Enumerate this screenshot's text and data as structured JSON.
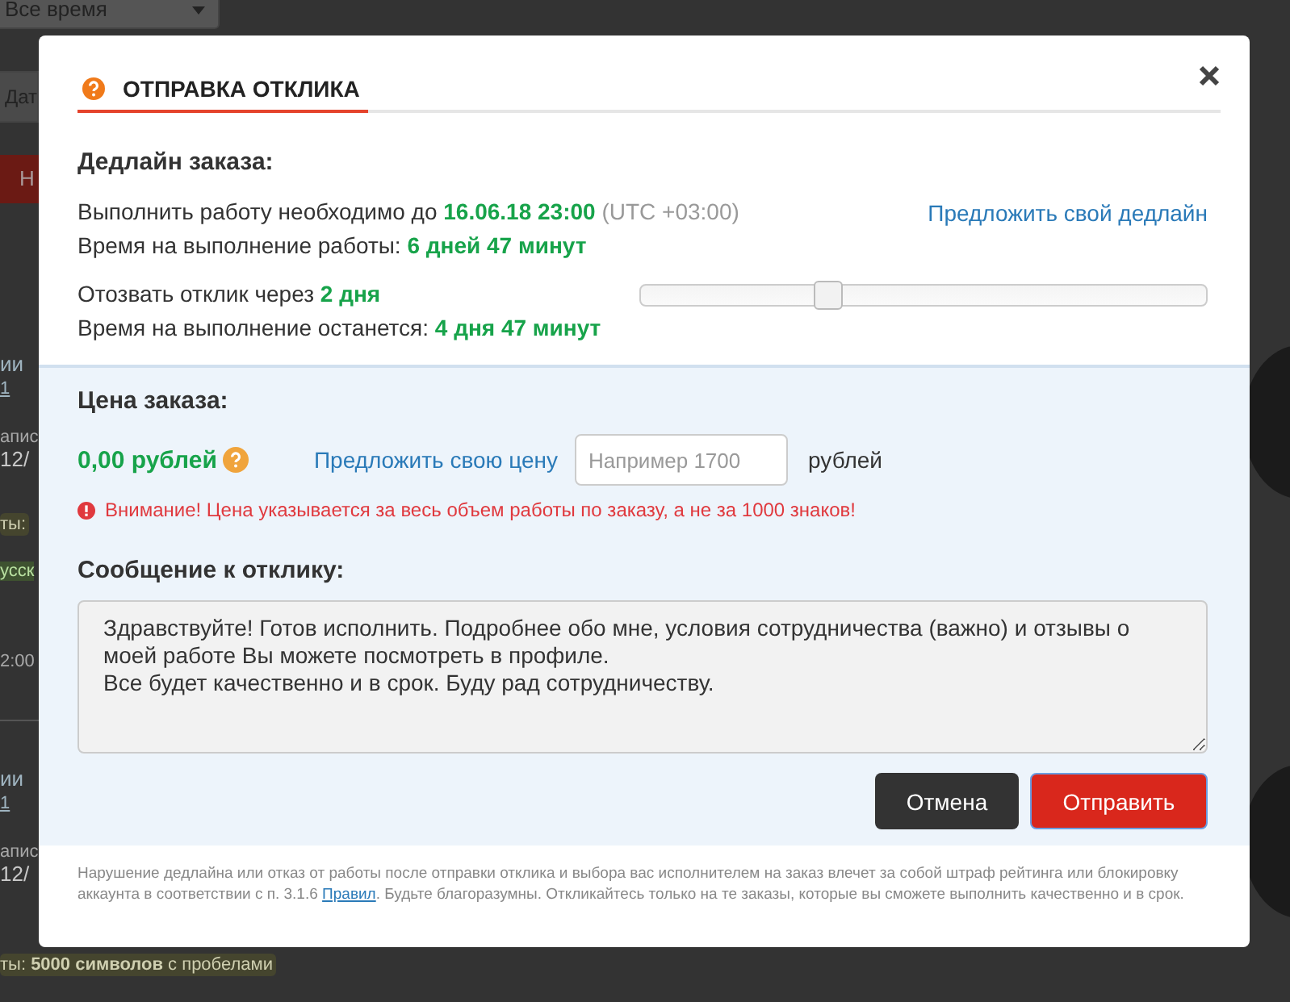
{
  "background": {
    "period_select": "Все время",
    "items": [
      {
        "kind": "field",
        "text": "Дат"
      },
      {
        "kind": "button",
        "text": "Н"
      },
      {
        "kind": "heading",
        "text": "ии"
      },
      {
        "kind": "link",
        "text": "1"
      },
      {
        "kind": "label",
        "text": "апис"
      },
      {
        "kind": "date",
        "text": "12/"
      },
      {
        "kind": "tag",
        "text": "ты:"
      },
      {
        "kind": "greentag",
        "text": "усск"
      },
      {
        "kind": "time",
        "text": "2:00"
      },
      {
        "kind": "divider"
      },
      {
        "kind": "heading",
        "text": "ии"
      },
      {
        "kind": "link",
        "text": "1"
      },
      {
        "kind": "label",
        "text": "апис"
      },
      {
        "kind": "date",
        "text": "12/"
      },
      {
        "kind": "tag",
        "text": "ты: **5000 символов** с пробелами"
      }
    ]
  },
  "dialog": {
    "title": "ОТПРАВКА ОТКЛИКА",
    "deadline": {
      "heading": "Дедлайн заказа:",
      "due_line": {
        "text": "Выполнить работу необходимо до",
        "value": "16.06.18 23:00",
        "timezone": "(UTC +03:00)"
      },
      "propose_link": "Предложить свой дедлайн",
      "time_line": {
        "text": "Время на выполнение работы:",
        "value": "6 дней 47 минут"
      },
      "withdraw_line": {
        "text": "Отозвать отклик через",
        "value": "2 дня"
      },
      "remaining_line": {
        "text": "Время на выполнение останется:",
        "value": "4 дня 47 минут"
      },
      "slider": {
        "level": 0.33
      }
    },
    "price": {
      "heading": "Цена заказа:",
      "amount": "0,00 рублей",
      "propose_link": "Предложить свою цену",
      "input_placeholder": "Например 1700",
      "unit": "рублей",
      "warning": "Внимание! Цена указывается за весь объем работы по заказу, а не за 1000 знаков!"
    },
    "message": {
      "heading": "Сообщение к отклику:",
      "value": "Здравствуйте! Готов исполнить. Подробнее обо мне, условия сотрудничества (важно) и отзывы о моей работе Вы можете посмотреть в профиле.\nВсе будет качественно и в срок. Буду рад сотрудничеству."
    },
    "buttons": [
      {
        "kind": "cancel",
        "label": "Отмена"
      },
      {
        "kind": "submit",
        "label": "Отправить"
      }
    ],
    "footer": {
      "before": "Нарушение дедлайна или отказ от работы после отправки отклика и выбора вас исполнителем на заказ влечет за собой штраф рейтинга или блокировку аккаунта в соответствии с п. 3.1.6",
      "link": "Правил",
      "after": ". Будьте благоразумны. Откликайтесь только на те заказы, которые вы сможете выполнить качественно и в срок."
    }
  }
}
